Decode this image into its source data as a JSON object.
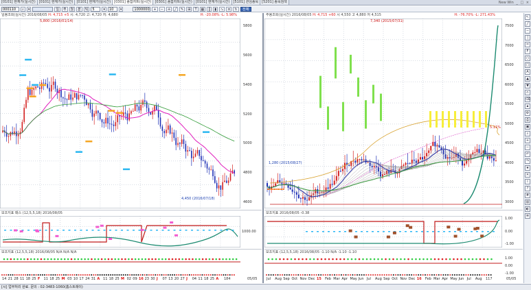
{
  "tabs": [
    {
      "label": "[0101] 현재가(실시간)"
    },
    {
      "label": "[0101] 현재가(실시간)"
    },
    {
      "label": "[0101] 현재가(실시간)"
    },
    {
      "label": "[0301] 종합차트(실시간)"
    },
    {
      "label": "[0301] 종합차트(실시간)"
    },
    {
      "label": "[0101] 현재가(실시간)"
    },
    {
      "label": "[5101] 관심종목"
    },
    {
      "label": "[5201] 종목검색"
    }
  ],
  "window_controls": {
    "label": "New Win"
  },
  "toolbar": {
    "code": "000110",
    "period": "5",
    "count": "10",
    "quantity": "1000000",
    "search_label": "전체"
  },
  "left_pane": {
    "header": "일봉조회(실시간) 2016/08/05",
    "header_price": "H: 4,715 +5",
    "header_quote": "시: 4,720 고: 4,720 저: 4,680",
    "range_label": "H: -20.08%  -L: 5.98%",
    "price_labels": [
      "5800",
      "5600",
      "5400",
      "5200",
      "5000",
      "4800",
      "4600"
    ],
    "high_annotation": "5,800 (2016/01/14)",
    "low_annotation": "4,450 (2016/07/18)",
    "x_labels": [
      "14",
      "21",
      "28",
      "11",
      "18",
      "25",
      "F",
      "11",
      "18",
      "25",
      "M",
      "03",
      "10",
      "17",
      "24",
      "31",
      "A",
      "11",
      "18",
      "25",
      "M",
      "02",
      "09",
      "16",
      "23",
      "30",
      "J",
      "07",
      "13",
      "20",
      "27",
      "J",
      "04",
      "11",
      "18",
      "25",
      "A"
    ],
    "indicator1_header": "보조지표 패스 (12,5,5,18) 2016/08/05",
    "indicator1_value": "1000.00",
    "indicator2_header": "보조지표 (12,5,5,18) 2016/08/05",
    "indicator2_vals": "N/A N/A N/A",
    "page_indicator": "184",
    "nav_right": "05/05"
  },
  "right_pane": {
    "header": "주봉조회(실시간) 2016/08/05",
    "header_price": "H: 4,715 +60",
    "header_quote": "시 4,550 고 4,880 저 4,515",
    "range_label": "H: -76.70%  -L: 271.43%",
    "high_annotation": "7,340 (2015/07/31)",
    "low_annotation": "1,280 (2015/08/27)",
    "pct_label": "5.11%",
    "price_labels": [
      "7500",
      "7000",
      "6500",
      "6000",
      "5500",
      "5000",
      "4500",
      "4000",
      "3500",
      "3000"
    ],
    "x_labels": [
      "Jul",
      "Aug",
      "Sep",
      "Oct",
      "Nov",
      "Dec",
      "15",
      "Feb",
      "Mar",
      "Apr",
      "May",
      "Jun",
      "Jul",
      "Aug",
      "Sep",
      "Oct",
      "Nov",
      "Dec",
      "16",
      "Feb",
      "Mar",
      "Apr",
      "May",
      "Jun",
      "Jul",
      "Aug"
    ],
    "indicator1_header": "보조지표 2016/08/05 -0.38",
    "indicator1_levels": [
      "1.00",
      "0.00",
      "-1.00"
    ],
    "indicator2_header": "보조지표 (12,5,5,18) 2016/08/05 -1.10 N/A -1.10 -1.10",
    "indicator2_levels": [
      "1.00",
      "0.00",
      "-1.00"
    ],
    "page_indicator": "117",
    "nav_right": "05/05"
  },
  "statusbar": {
    "text": "[시] 업무처리 완료. 문의 : 02-3483-1060(홈스트레이)"
  },
  "colors": {
    "up": "#d42020",
    "down": "#1d2fb5",
    "ma_short": "#e01dbd",
    "ma_long": "#2f9a35",
    "osc": "#1b8a70",
    "guide": "#c01818"
  }
}
